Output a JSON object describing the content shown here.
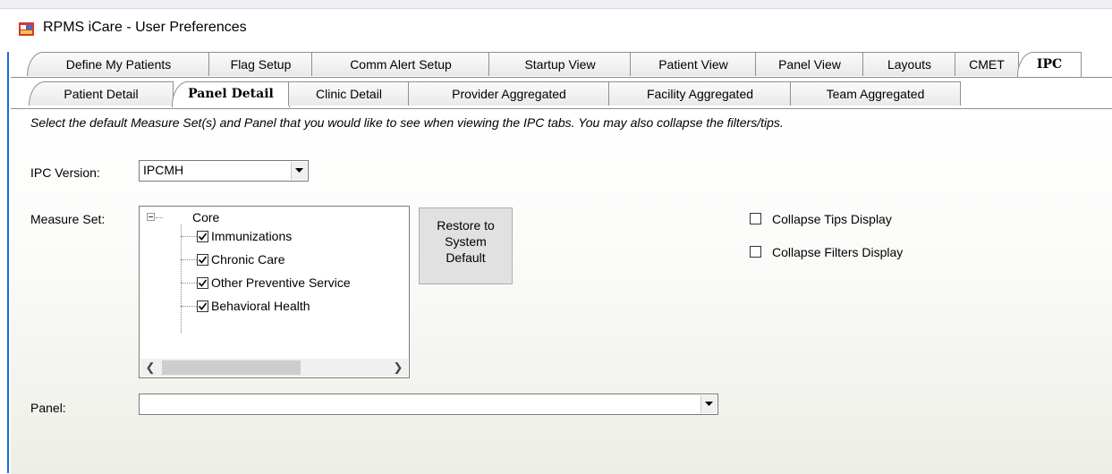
{
  "window": {
    "title": "RPMS iCare - User Preferences",
    "icon": "app-window-icon"
  },
  "main_tabs": [
    {
      "label": "Define My Patients"
    },
    {
      "label": "Flag Setup"
    },
    {
      "label": "Comm Alert Setup"
    },
    {
      "label": "Startup View"
    },
    {
      "label": "Patient View"
    },
    {
      "label": "Panel View"
    },
    {
      "label": "Layouts"
    },
    {
      "label": "CMET"
    },
    {
      "label": "IPC",
      "active": true
    }
  ],
  "sub_tabs": [
    {
      "label": "Patient Detail"
    },
    {
      "label": "Panel Detail",
      "active": true
    },
    {
      "label": "Clinic Detail"
    },
    {
      "label": "Provider Aggregated"
    },
    {
      "label": "Facility Aggregated"
    },
    {
      "label": "Team Aggregated"
    }
  ],
  "content": {
    "instructions": "Select the default Measure Set(s) and Panel that you would like to see when viewing the IPC tabs. You may also collapse the filters/tips.",
    "ipc_version": {
      "label": "IPC Version:",
      "value": "IPCMH"
    },
    "measure_set": {
      "label": "Measure Set:",
      "root": {
        "label": "Core",
        "expanded": true
      },
      "items": [
        {
          "label": "Immunizations",
          "checked": true
        },
        {
          "label": "Chronic Care",
          "checked": true
        },
        {
          "label": "Other Preventive Service",
          "checked": true
        },
        {
          "label": "Behavioral Health",
          "checked": true
        }
      ]
    },
    "restore_button": {
      "line1": "Restore to",
      "line2": "System",
      "line3": "Default"
    },
    "options": {
      "collapse_tips": {
        "label": "Collapse Tips Display",
        "checked": false
      },
      "collapse_filters": {
        "label": "Collapse Filters Display",
        "checked": false
      }
    },
    "panel": {
      "label": "Panel:",
      "value": ""
    }
  },
  "colors": {
    "window_border": "#1c6ed6",
    "tab_border": "#8f8f8f",
    "content_bottom": "#eceee6"
  }
}
